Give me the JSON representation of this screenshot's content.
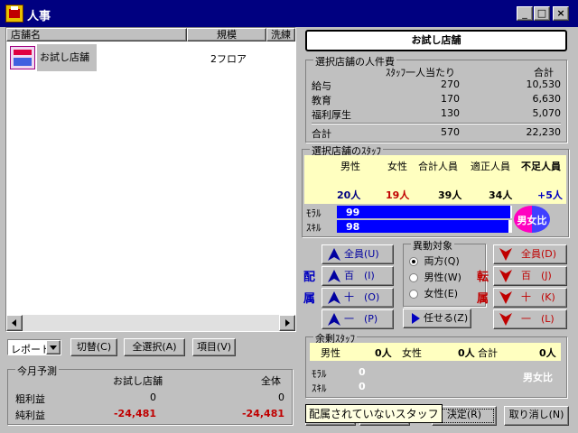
{
  "window": {
    "title": "人事",
    "caption_buttons": [
      "_",
      "□",
      "×"
    ]
  },
  "list": {
    "columns": [
      "店舗名",
      "規模",
      "洗練"
    ],
    "rows": [
      {
        "name": "お試し店舗",
        "size": "2フロア"
      }
    ]
  },
  "toolbar": {
    "report_select": "レポート",
    "switch": "切替(C)",
    "select_all": "全選択(A)",
    "items": "項目(V)"
  },
  "forecast": {
    "title": "今月予測",
    "col_store": "お試し店舗",
    "col_total": "全体",
    "rows": [
      {
        "label": "粗利益",
        "store": "0",
        "total": "0"
      },
      {
        "label": "純利益",
        "store": "-24,481",
        "total": "-24,481"
      }
    ]
  },
  "store_title": "お試し店舗",
  "labor": {
    "title": "選択店舗の人件費",
    "col_per": "ｽﾀｯﾌ一人当たり",
    "col_total": "合計",
    "rows": [
      {
        "label": "給与",
        "per": "270",
        "total": "10,530"
      },
      {
        "label": "教育",
        "per": "170",
        "total": "6,630"
      },
      {
        "label": "福利厚生",
        "per": "130",
        "total": "5,070"
      }
    ],
    "sum": {
      "label": "合計",
      "per": "570",
      "total": "22,230"
    }
  },
  "staff": {
    "title": "選択店舗のｽﾀｯﾌ",
    "headers": [
      "男性",
      "女性",
      "合計人員",
      "適正人員",
      "不足人員"
    ],
    "values": [
      "20人",
      "19人",
      "39人",
      "34人",
      "+5人"
    ],
    "morale_label": "ﾓﾗﾙ",
    "morale": "99",
    "skill_label": "ｽｷﾙ",
    "skill": "98",
    "morale_level": 0.99,
    "skill_level": 0.98,
    "ratio_label": "男女比"
  },
  "assign": {
    "side_label": [
      "配",
      "属"
    ],
    "buttons": [
      "全員(U)",
      "百　(I)",
      "十　(O)",
      "一　(P)"
    ]
  },
  "target": {
    "title": "異動対象",
    "options": [
      "両方(Q)",
      "男性(W)",
      "女性(E)"
    ],
    "selected": 0,
    "delegate": "任せる(Z)"
  },
  "transfer": {
    "side_label": [
      "転",
      "属"
    ],
    "buttons": [
      "全員(D)",
      "百　(J)",
      "十　(K)",
      "一　(L)"
    ]
  },
  "surplus": {
    "title": "余剰ｽﾀｯﾌ",
    "male_label": "男性",
    "male": "0人",
    "female_label": "女性",
    "female": "0人",
    "total_label": "合計",
    "total": "0人",
    "morale_label": "ﾓﾗﾙ",
    "morale": "0",
    "skill_label": "ｽｷﾙ",
    "skill": "0",
    "ratio_label": "男女比"
  },
  "footer": {
    "tooltip": "配属されていないスタッフ",
    "ok": "決定(R)",
    "cancel": "取り消し(N)"
  },
  "colors": {
    "titlebar": "#000080",
    "list_select": "#000080",
    "yellow": "#ffffc0",
    "bar": "#0000ff",
    "red": "#c00000"
  }
}
